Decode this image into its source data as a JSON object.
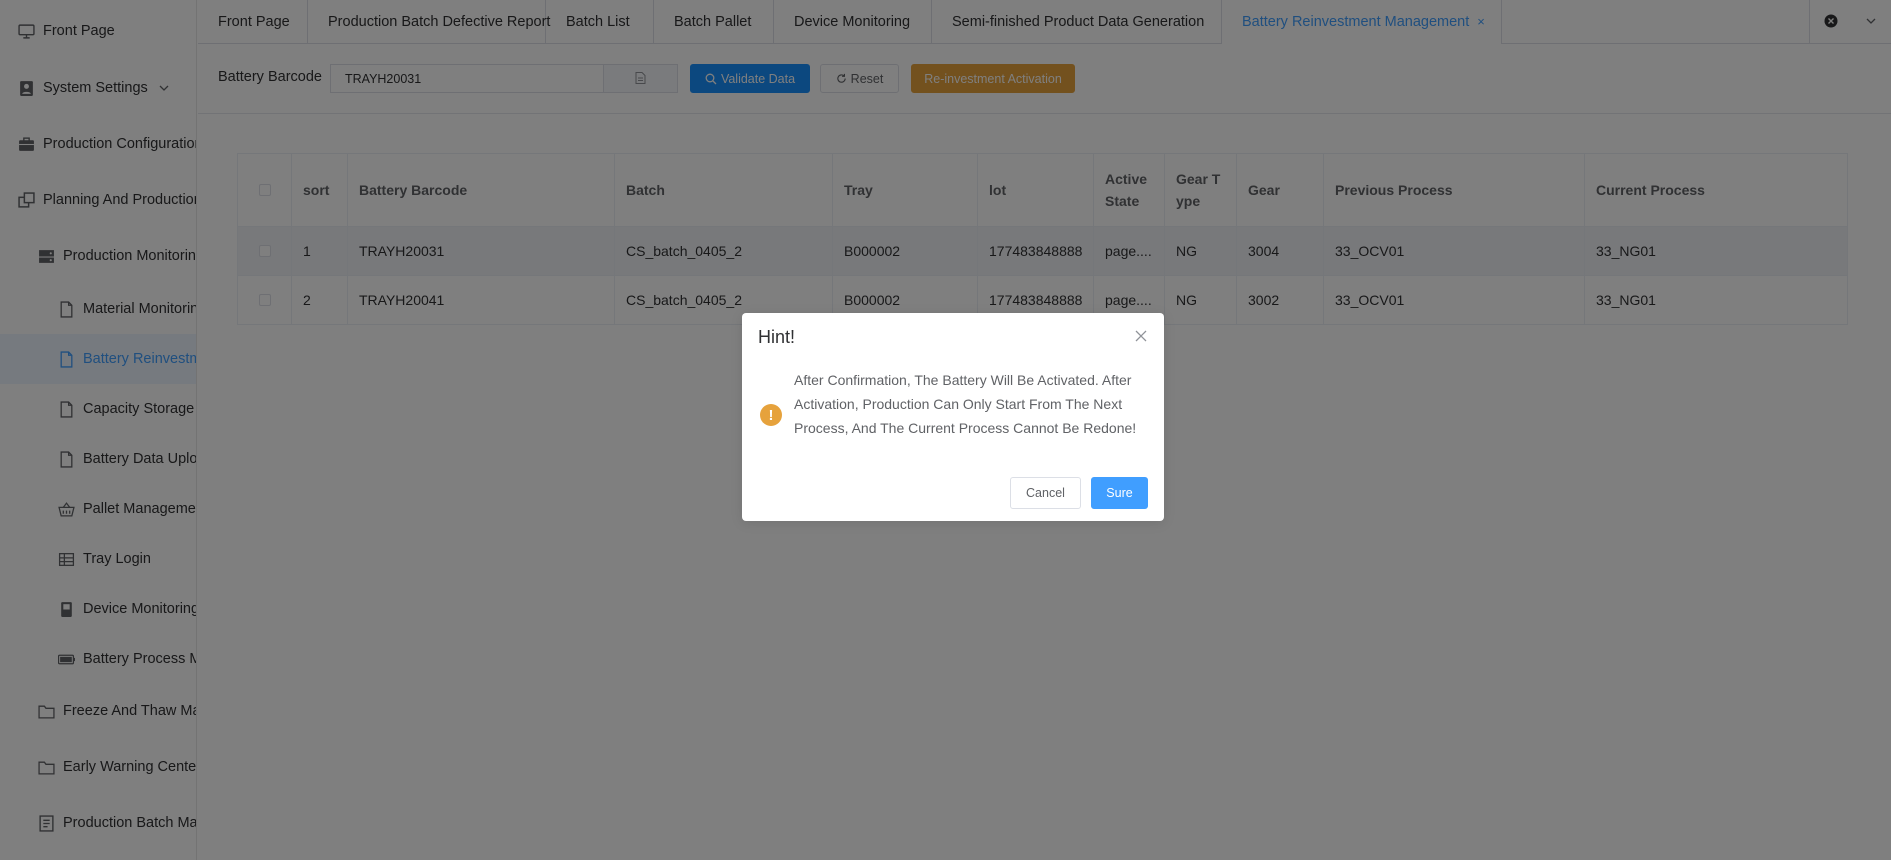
{
  "sidebar": {
    "items": [
      {
        "label": "Front Page",
        "icon": "monitor-icon"
      },
      {
        "label": "System Settings",
        "icon": "user-icon"
      },
      {
        "label": "Production Configuration",
        "icon": "briefcase-icon"
      },
      {
        "label": "Planning And Production",
        "icon": "windows-icon"
      },
      {
        "label": "Production Monitoring",
        "icon": "server-icon"
      },
      {
        "label": "Material Monitoring",
        "icon": "document-icon"
      },
      {
        "label": "Battery Reinvestment Management",
        "icon": "document-icon"
      },
      {
        "label": "Capacity Storage L",
        "icon": "document-icon"
      },
      {
        "label": "Battery Data Upload",
        "icon": "document-icon"
      },
      {
        "label": "Pallet Management",
        "icon": "basket-icon"
      },
      {
        "label": "Tray Login",
        "icon": "grid-icon"
      },
      {
        "label": "Device Monitoring",
        "icon": "device-icon"
      },
      {
        "label": "Battery Process Management",
        "icon": "battery-icon"
      },
      {
        "label": "Freeze And Thaw Management",
        "icon": "folder-icon"
      },
      {
        "label": "Early Warning Center",
        "icon": "folder-icon"
      },
      {
        "label": "Production Batch Management",
        "icon": "notebook-icon"
      }
    ]
  },
  "tabs": [
    {
      "label": "Front Page"
    },
    {
      "label": "Production Batch Defective Report"
    },
    {
      "label": "Batch List"
    },
    {
      "label": "Batch Pallet"
    },
    {
      "label": "Device Monitoring"
    },
    {
      "label": "Semi-finished Product Data Generation"
    },
    {
      "label": "Battery Reinvestment Management",
      "active": true
    }
  ],
  "tab_close_glyph": "×",
  "toolbar": {
    "barcode_label": "Battery Barcode",
    "barcode_value": "TRAYH20031",
    "validate_label": "Validate Data",
    "reset_label": "Reset",
    "activate_label": "Re-investment Activation"
  },
  "table": {
    "headers": [
      "sort",
      "Battery Barcode",
      "Batch",
      "Tray",
      "lot",
      "Active State",
      "Gear T ype",
      "Gear",
      "Previous Process",
      "Current Process"
    ],
    "rows": [
      {
        "sort": "1",
        "barcode": "TRAYH20031",
        "batch": "CS_batch_0405_2",
        "tray": "B000002",
        "lot": "177483848888",
        "active": "page....",
        "gear_type": "NG",
        "gear": "3004",
        "prev": "33_OCV01",
        "curr": "33_NG01"
      },
      {
        "sort": "2",
        "barcode": "TRAYH20041",
        "batch": "CS_batch_0405_2",
        "tray": "B000002",
        "lot": "177483848888",
        "active": "page....",
        "gear_type": "NG",
        "gear": "3002",
        "prev": "33_OCV01",
        "curr": "33_NG01"
      }
    ]
  },
  "dialog": {
    "title": "Hint!",
    "icon_glyph": "!",
    "message": "After Confirmation, The Battery Will Be Activated. After Activation, Production Can Only Start From The Next Process, And The Current Process Cannot Be Redone!",
    "cancel_label": "Cancel",
    "confirm_label": "Sure"
  },
  "colors": {
    "accent": "#409eff",
    "warning": "#e6a23c",
    "primary_button": "#1890ff"
  }
}
